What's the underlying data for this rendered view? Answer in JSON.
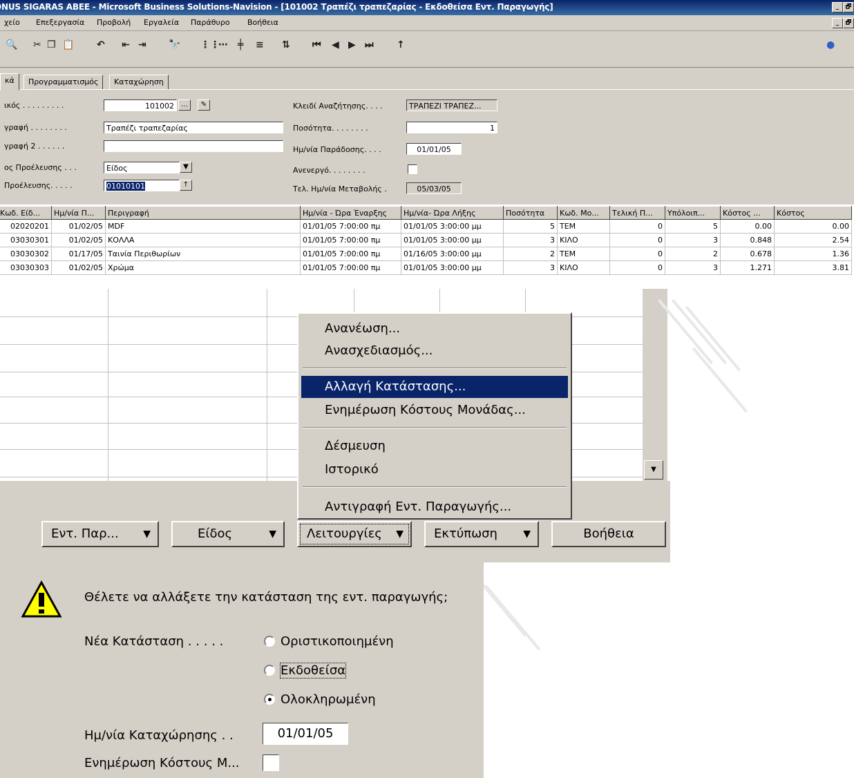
{
  "window": {
    "title": "ONUS SIGARAS ABEE - Microsoft Business Solutions-Navision - [101002 Τραπέζι τραπεζαρίας - Εκδοθείσα Εντ. Παραγωγής]",
    "min_label": "_",
    "restore_label": "🗗"
  },
  "menubar": [
    "Αρχείο",
    "Επεξεργασία",
    "Προβολή",
    "Εργαλεία",
    "Παράθυρο",
    "Βοήθεια"
  ],
  "menubar_visible": [
    "χείο",
    "Επεξεργασία",
    "Προβολή",
    "Εργαλεία",
    "Παράθυρο",
    "Βοήθεια"
  ],
  "toolbar_icons": [
    "print-preview-icon",
    "cut-icon",
    "copy-icon",
    "paste-icon",
    "undo-icon",
    "indent-icon",
    "outdent-icon",
    "find-icon",
    "grid1-icon",
    "grid2-icon",
    "grid3-icon",
    "list-icon",
    "sort-icon",
    "first-icon",
    "prev-icon",
    "next-icon",
    "last-icon",
    "up-icon",
    "help-icon"
  ],
  "tabs": [
    "κά",
    "Προγραμματισμός",
    "Καταχώρηση"
  ],
  "form": {
    "code_label": "ικός . . . . . . . . .",
    "code_value": "101002",
    "desc_label": "γραφή . . . . . . . .",
    "desc_value": "Τραπέζι τραπεζαρίας",
    "desc2_label": "γραφή 2 . . . . . .",
    "desc2_value": "",
    "origin_type_label": "ος Προέλευσης . . .",
    "origin_type_value": "Είδος",
    "origin_no_label": "Προέλευσης. . . . .",
    "origin_no_value": "01010101",
    "search_key_label": "Κλειδί Αναζήτησης. . . .",
    "search_key_value": "ΤΡΑΠΕΖΙ ΤΡΑΠΕΖ...",
    "qty_label": "Ποσότητα. . . . . . . .",
    "qty_value": "1",
    "due_date_label": "Ημ/νία Παράδοσης. . . .",
    "due_date_value": "01/01/05",
    "inactive_label": "Ανενεργό. . . . . . . .",
    "last_modified_label": "Τελ. Ημ/νία Μεταβολής .",
    "last_modified_value": "05/03/05"
  },
  "grid": {
    "columns": [
      "Κωδ. Είδ...",
      "Ημ/νία Π...",
      "Περιγραφή",
      "Ημ/νία - Ώρα Έναρξης",
      "Ημ/νία- Ώρα Λήξης",
      "Ποσότητα",
      "Κωδ. Μο...",
      "Τελική Π...",
      "Υπόλοιπ...",
      "Κόστος ...",
      "Κόστος"
    ],
    "rows": [
      [
        "02020201",
        "01/02/05",
        "MDF",
        "01/01/05  7:00:00 πμ",
        "01/01/05  3:00:00 μμ",
        "5",
        "TEM",
        "0",
        "5",
        "0.00",
        "0.00"
      ],
      [
        "03030301",
        "01/02/05",
        "ΚΟΛΛΑ",
        "01/01/05  7:00:00 πμ",
        "01/01/05  3:00:00 μμ",
        "3",
        "ΚΙΛΟ",
        "0",
        "3",
        "0.848",
        "2.54"
      ],
      [
        "03030302",
        "01/17/05",
        "Ταινία Περιθωρίων",
        "01/01/05  7:00:00 πμ",
        "01/16/05  3:00:00 μμ",
        "2",
        "TEM",
        "0",
        "2",
        "0.678",
        "1.36"
      ],
      [
        "03030303",
        "01/02/05",
        "Χρώμα",
        "01/01/05  7:00:00 πμ",
        "01/01/05  3:00:00 μμ",
        "3",
        "ΚΙΛΟ",
        "0",
        "3",
        "1.271",
        "3.81"
      ]
    ]
  },
  "popup_menu": {
    "items": [
      "Ανανέωση...",
      "Ανασχεδιασμός...",
      "Αλλαγή Κατάστασης...",
      "Ενημέρωση Κόστους Μονάδας...",
      "Δέσμευση",
      "Ιστορικό",
      "Αντιγραφή Εντ. Παραγωγής..."
    ],
    "highlighted": "Αλλαγή Κατάστασης..."
  },
  "buttons": {
    "order": "Εντ. Παρ...",
    "item": "Είδος",
    "functions": "Λειτουργίες",
    "print": "Εκτύπωση",
    "help": "Βοήθεια"
  },
  "dialog": {
    "icon": "warning-icon",
    "question": "Θέλετε να αλλάξετε την κατάσταση της εντ. παραγωγής;",
    "new_status_label": "Νέα Κατάσταση . . . . .",
    "options": [
      "Οριστικοποιημένη",
      "Εκδοθείσα",
      "Ολοκληρωμένη"
    ],
    "selected": "Ολοκληρωμένη",
    "posting_date_label": "Ημ/νία Καταχώρησης  . .",
    "posting_date_value": "01/01/05",
    "update_cost_label": "Ενημέρωση Κόστους Μ..."
  },
  "colors": {
    "title_bar": "#0a246a",
    "face": "#d4d0c8",
    "highlight": "#0a246a",
    "warning_yellow": "#ffff00"
  }
}
